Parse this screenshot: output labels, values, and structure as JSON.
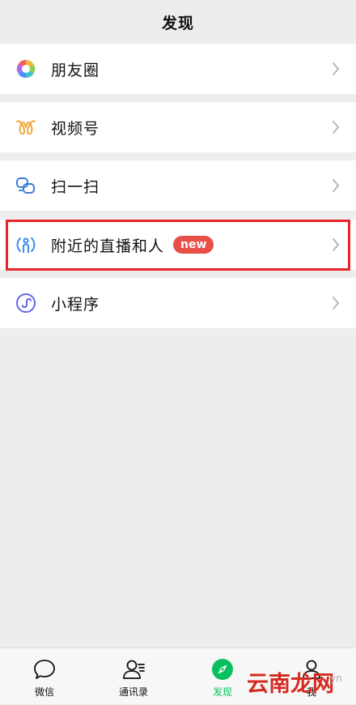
{
  "header": {
    "title": "发现"
  },
  "items": [
    {
      "label": "朋友圈",
      "icon": "moments-icon"
    },
    {
      "label": "视频号",
      "icon": "channels-icon"
    },
    {
      "label": "扫一扫",
      "icon": "scan-icon"
    },
    {
      "label": "附近的直播和人",
      "icon": "nearby-live-icon",
      "badge": "new"
    },
    {
      "label": "小程序",
      "icon": "mini-program-icon"
    }
  ],
  "tabbar": {
    "tabs": [
      {
        "label": "微信",
        "icon": "chat-icon"
      },
      {
        "label": "通讯录",
        "icon": "contacts-icon"
      },
      {
        "label": "发现",
        "icon": "discover-icon",
        "active": true
      },
      {
        "label": "我",
        "icon": "me-icon"
      }
    ]
  },
  "watermark": {
    "text": "云南龙网",
    "suffix": "yn"
  },
  "colors": {
    "accent": "#07c160",
    "badge": "#e84f46",
    "highlight": "#e8262a",
    "background": "#ededed"
  }
}
